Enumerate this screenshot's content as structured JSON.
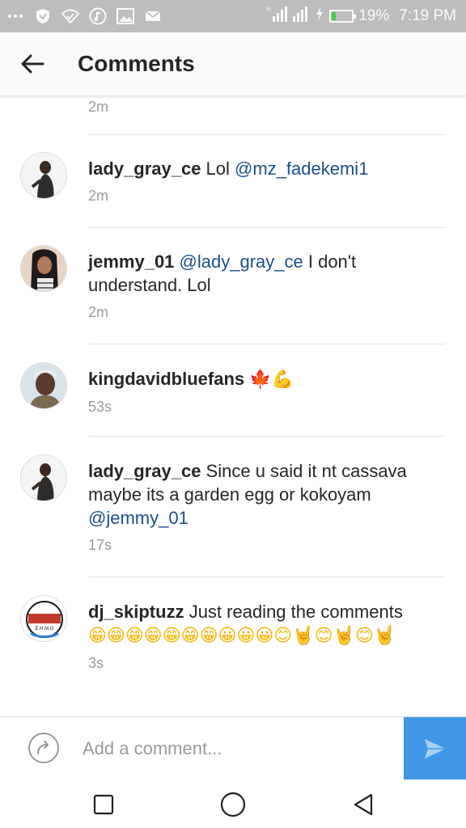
{
  "status_bar": {
    "battery_percent": 19,
    "battery_text": "19%",
    "time": "7:19 PM",
    "network_label": "H",
    "left_icons": [
      "more-icon",
      "shield-icon",
      "wifi-check-icon",
      "music-icon",
      "image-icon",
      "mail-icon"
    ]
  },
  "header": {
    "title": "Comments"
  },
  "partial_comment": {
    "time": "2m"
  },
  "comments": [
    {
      "username": "lady_gray_ce",
      "pre": " Lol ",
      "mention": "@mz_fadekemi1",
      "post": "",
      "time": "2m"
    },
    {
      "username": "jemmy_01",
      "pre": " ",
      "mention": "@lady_gray_ce",
      "post": " I don't understand. Lol",
      "time": "2m"
    },
    {
      "username": "kingdavidbluefans",
      "pre": " ",
      "emoji": "🍁💪",
      "time": "53s"
    },
    {
      "username": "lady_gray_ce",
      "pre": " Since u said it nt cassava maybe its a garden egg or kokoyam ",
      "mention": "@jemmy_01",
      "post": "",
      "time": "17s"
    },
    {
      "username": "dj_skiptuzz",
      "pre": " Just reading the comments ",
      "emoji": "😁😁😁😁😁😁😁😀😀😀😊🤘😊🤘😊🤘",
      "time": "3s"
    }
  ],
  "avatar_text": "E.H.M.G",
  "input": {
    "placeholder": "Add a comment..."
  },
  "colors": {
    "mention": "#1b4f8a",
    "send_button": "#3f97e6",
    "status_bar": "#bdbdbd"
  }
}
